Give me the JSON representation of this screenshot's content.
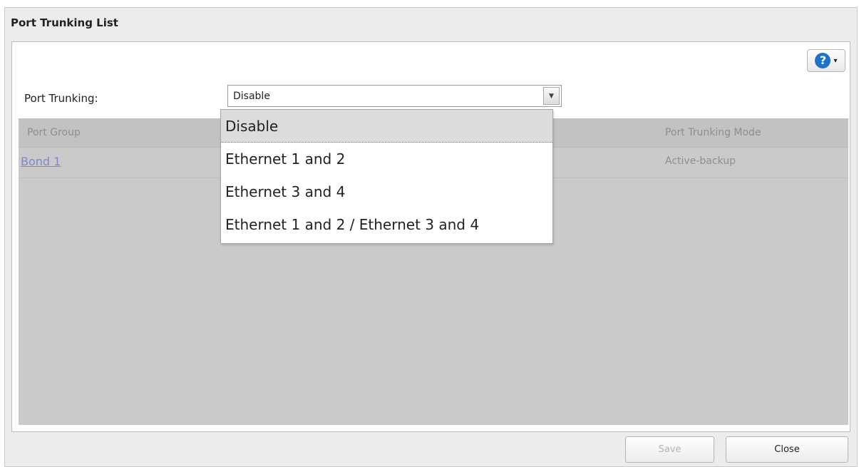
{
  "window": {
    "title": "Port Trunking List"
  },
  "help": {
    "icon": "help-icon",
    "caret": "▾"
  },
  "form": {
    "label": "Port Trunking:",
    "select_value": "Disable",
    "options": [
      "Disable",
      "Ethernet 1 and 2",
      "Ethernet 3 and 4",
      "Ethernet 1 and 2 / Ethernet 3 and 4"
    ]
  },
  "table": {
    "columns": [
      "Port Group",
      "Port Trunking Mode"
    ],
    "rows": [
      {
        "port_group": "Bond 1",
        "mode": "Active-backup"
      }
    ]
  },
  "buttons": {
    "save": "Save",
    "close": "Close"
  },
  "colors": {
    "accent": "#1e73c8",
    "grid_bg": "#cacaca",
    "link": "#7b86d6"
  }
}
